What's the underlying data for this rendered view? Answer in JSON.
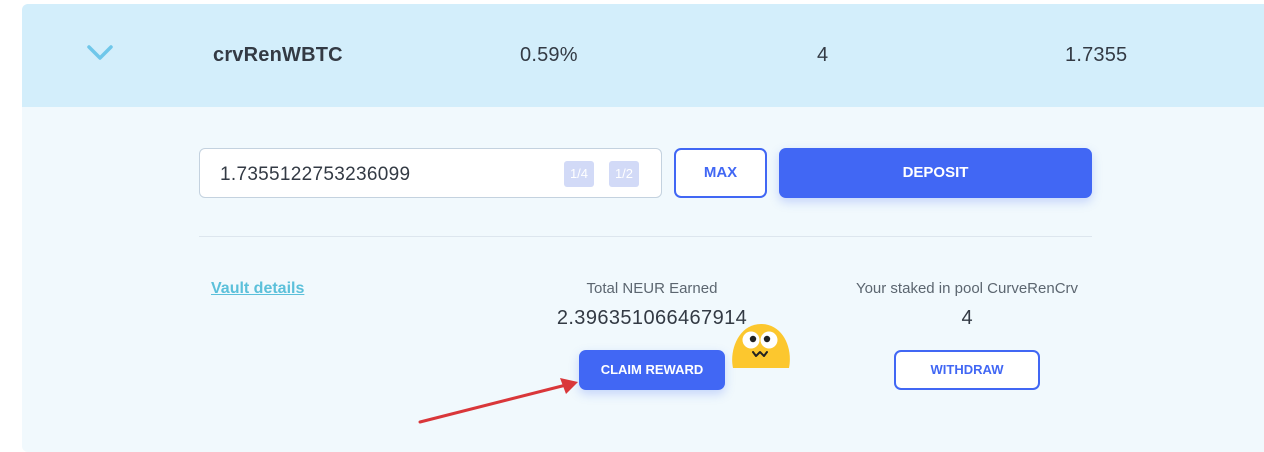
{
  "pool_row": {
    "name": "crvRenWBTC",
    "apy": "0.59%",
    "staked": "4",
    "balance": "1.7355",
    "expand_icon": "chevron-down-icon"
  },
  "deposit": {
    "amount_value": "1.7355122753236099",
    "quarter_label": "1/4",
    "half_label": "1/2",
    "max_label": "MAX",
    "deposit_label": "DEPOSIT"
  },
  "details": {
    "vault_link": "Vault details",
    "earned_label": "Total NEUR Earned",
    "earned_value": "2.396351066467914",
    "claim_label": "CLAIM REWARD",
    "staked_label": "Your staked in pool CurveRenCrv",
    "staked_value": "4",
    "withdraw_label": "WITHDRAW"
  },
  "colors": {
    "accent": "#4167f4",
    "header_bg": "#d3eefb",
    "panel_bg": "#f1f9fd",
    "link": "#5bc0da",
    "annotation_arrow": "#d9373a"
  }
}
